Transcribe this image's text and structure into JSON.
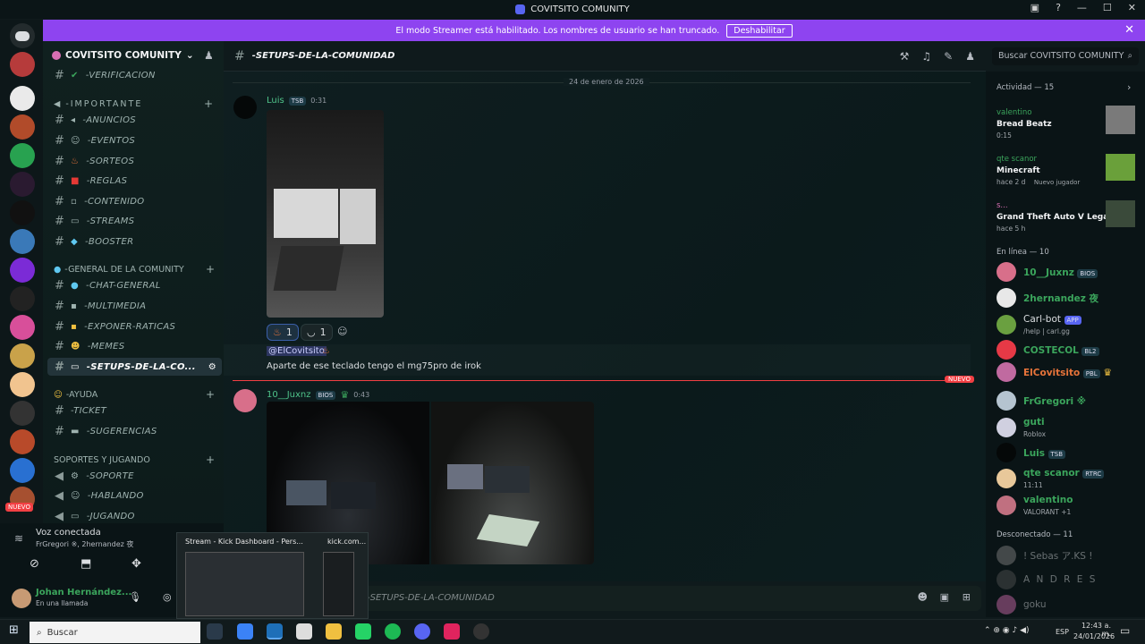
{
  "window": {
    "title": "COVITSITO COMUNITY"
  },
  "banner": {
    "text": "El modo Streamer está habilitado. Los nombres de usuario se han truncado.",
    "button": "Deshabilitar"
  },
  "server": {
    "name": "COVITSITO COMUNITY"
  },
  "channels": {
    "verificacion": "-VERIFICACION",
    "cat_importante": "-IMPORTANTE",
    "anuncios": "-ANUNCIOS",
    "eventos": "-EVENTOS",
    "sorteos": "-SORTEOS",
    "reglas": "-REGLAS",
    "contenido": "-CONTENIDO",
    "streams": "-STREAMS",
    "booster": "-BOOSTER",
    "cat_general": "-GENERAL DE LA COMUNITY",
    "chat_general": "-CHAT-GENERAL",
    "multimedia": "-MULTIMEDIA",
    "exponer": "-EXPONER-RATICAS",
    "memes": "-MEMES",
    "setups": "-SETUPS-DE-LA-CO...",
    "cat_ayuda": "-AYUDA",
    "ticket": "-TICKET",
    "sugerencias": "-SUGERENCIAS",
    "cat_soportes": "SOPORTES Y JUGANDO",
    "soporte": "-SOPORTE",
    "hablando": "-HABLANDO",
    "jugando": "-JUGANDO"
  },
  "voice": {
    "title": "Voz conectada",
    "users": "FrGregori ※, 2hernandez 夜",
    "user": "Johan Hernández...",
    "status": "En una llamada"
  },
  "header": {
    "channel": "-SETUPS-DE-LA-COMUNIDAD",
    "search": "Buscar COVITSITO COMUNITY"
  },
  "chat": {
    "date": "24 de enero de 2026",
    "msg1": {
      "author": "Luis",
      "tag": "TSB",
      "time": "0:31",
      "reaction1": "1",
      "reaction2": "1"
    },
    "reply": {
      "mention": "@ElCovitsito",
      "text": "Aparte de ese teclado tengo el mg75pro de irok"
    },
    "new": "NUEVO",
    "msg2": {
      "author": "10__Juxnz",
      "tag": "BIOS",
      "time": "0:43"
    },
    "composer": "-SETUPS-DE-LA-COMUNIDAD"
  },
  "activity": {
    "title": "Actividad — 15",
    "items": [
      {
        "user": "valentino",
        "title": "Bread Beatz",
        "sub": "0:15"
      },
      {
        "user": "qte scanor",
        "title": "Minecraft",
        "sub": "hace 2 d",
        "extra": "Nuevo jugador"
      },
      {
        "user": "s...",
        "title": "Grand Theft Auto V Legacy",
        "sub": "hace 5 h"
      }
    ]
  },
  "online": {
    "title": "En línea — 10",
    "members": [
      {
        "name": "10__Juxnz",
        "tag": "BIOS",
        "sub": "",
        "color": "#3ba55c"
      },
      {
        "name": "2hernandez 夜",
        "tag": "",
        "sub": "",
        "color": "#3ba55c"
      },
      {
        "name": "Carl-bot",
        "tag": "APP",
        "sub": "/help | carl.gg",
        "color": "#dbdee1"
      },
      {
        "name": "COSTECOL",
        "tag": "BL2",
        "sub": "",
        "color": "#3ba55c"
      },
      {
        "name": "ElCovitsito",
        "tag": "PBL",
        "sub": "",
        "color": "#e8743a"
      },
      {
        "name": "FrGregori ※",
        "tag": "",
        "sub": "",
        "color": "#3ba55c"
      },
      {
        "name": "guti",
        "tag": "",
        "sub": "Roblox",
        "color": "#3ba55c"
      },
      {
        "name": "Luis",
        "tag": "TSB",
        "sub": "",
        "color": "#3ba55c"
      },
      {
        "name": "qte scanor",
        "tag": "RTRC",
        "sub": "11:11",
        "color": "#3ba55c"
      },
      {
        "name": "valentino",
        "tag": "",
        "sub": "VALORANT +1",
        "color": "#3ba55c"
      }
    ]
  },
  "offline": {
    "title": "Desconectado — 11",
    "members": [
      "! Sebas ア.KS !",
      "A N D R E S",
      "goku"
    ]
  },
  "taskbar": {
    "search": "Buscar",
    "time": "12:43 a. m.",
    "date": "24/01/2026",
    "lang": "ESP"
  },
  "popup": {
    "item1": "Stream - Kick Dashboard - Pers...",
    "item2": "kick.com..."
  }
}
